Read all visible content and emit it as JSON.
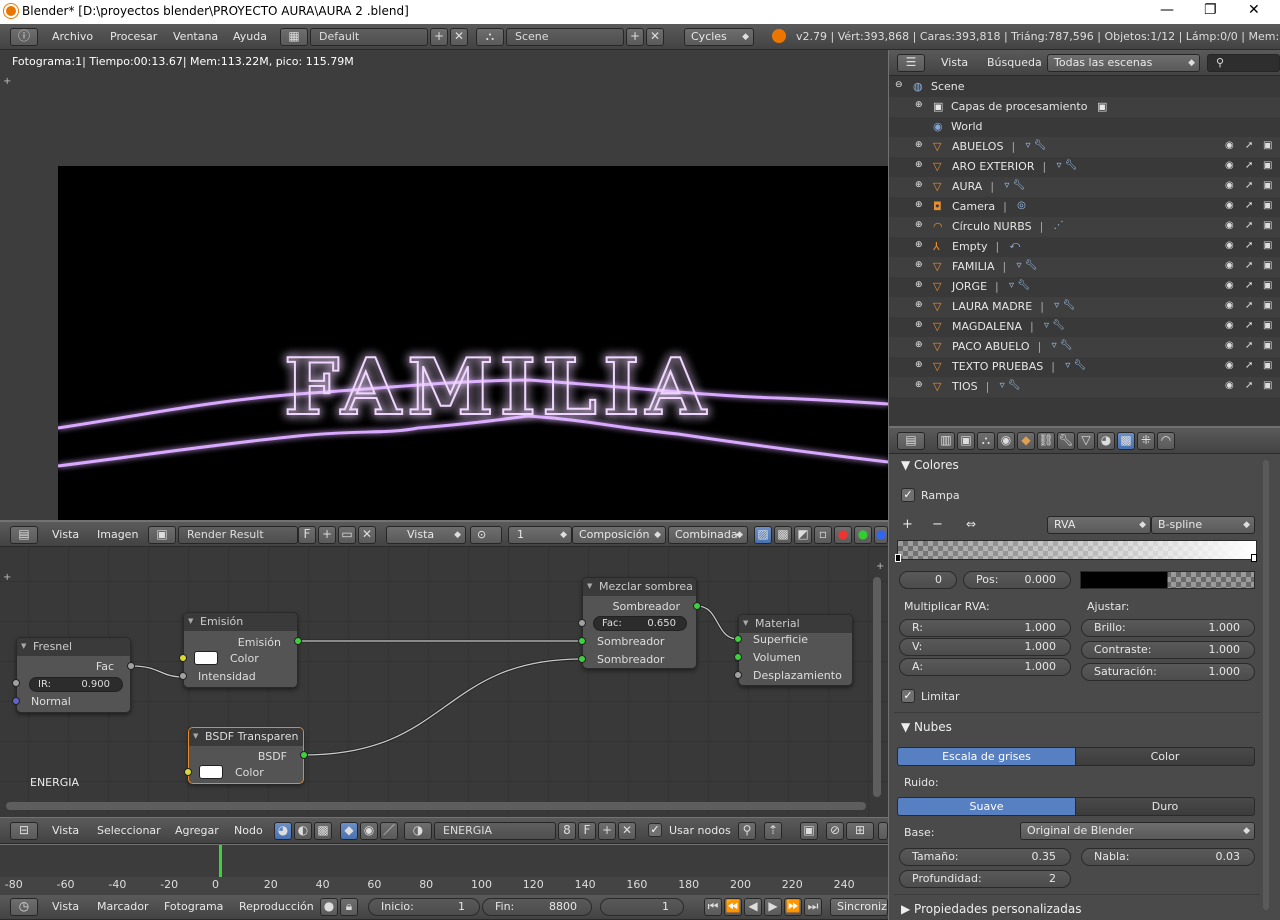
{
  "window": {
    "title": "Blender* [D:\\proyectos blender\\PROYECTO AURA\\AURA 2 .blend]"
  },
  "info_header": {
    "menus": [
      "Archivo",
      "Procesar",
      "Ventana",
      "Ayuda"
    ],
    "layout": "Default",
    "scene": "Scene",
    "engine": "Cycles",
    "stats": "v2.79 | Vért:393,868 | Caras:393,818 | Triáng:787,596 | Objetos:1/12 | Lámp:0/0 | Mem:373.5"
  },
  "render_view": {
    "info": "Fotograma:1| Tiempo:00:13.67| Mem:113.22M, pico: 115.79M",
    "text": "FAMILIA",
    "glow_color": "#c98cff"
  },
  "image_header": {
    "menus": [
      "Vista",
      "Imagen"
    ],
    "image": "Render Result",
    "f_label": "F",
    "view": "Vista",
    "slot": "1",
    "layer": "Composición",
    "pass": "Combinada"
  },
  "nodes": {
    "fresnel": {
      "title": "Fresnel",
      "out": "Fac",
      "field_label": "IR:",
      "field_value": "0.900",
      "in": "Normal"
    },
    "emission": {
      "title": "Emisión",
      "out": "Emisión",
      "color": "Color",
      "strength": "Intensidad"
    },
    "mix": {
      "title": "Mezclar sombrea",
      "out": "Sombreador",
      "fac_label": "Fac:",
      "fac_value": "0.650",
      "in1": "Sombreador",
      "in2": "Sombreador"
    },
    "material": {
      "title": "Material",
      "in1": "Superficie",
      "in2": "Volumen",
      "in3": "Desplazamiento"
    },
    "transparent": {
      "title": "BSDF Transparen",
      "out": "BSDF",
      "color": "Color"
    },
    "tree_label": "ENERGIA"
  },
  "node_header": {
    "menus": [
      "Vista",
      "Seleccionar",
      "Agregar",
      "Nodo"
    ],
    "material": "ENERGIA",
    "users": "8",
    "f_label": "F",
    "use_nodes_label": "Usar nodos",
    "use_nodes": true
  },
  "timeline": {
    "ticks": [
      "-80",
      "-60",
      "-40",
      "-20",
      "0",
      "20",
      "40",
      "60",
      "80",
      "100",
      "120",
      "140",
      "160",
      "180",
      "200",
      "220",
      "240"
    ],
    "menus": [
      "Vista",
      "Marcador",
      "Fotograma",
      "Reproducción"
    ],
    "start_label": "Inicio:",
    "start": "1",
    "end_label": "Fin:",
    "end": "8800",
    "current": "1",
    "sync": "Sincroniza"
  },
  "outliner": {
    "menus": [
      "Vista",
      "Búsqueda"
    ],
    "filter": "Todas las escenas",
    "scene": "Scene",
    "render_layers": "Capas de procesamiento",
    "world": "World",
    "objects": [
      {
        "name": "ABUELOS",
        "type": "mesh"
      },
      {
        "name": "ARO EXTERIOR",
        "type": "mesh"
      },
      {
        "name": "AURA",
        "type": "mesh"
      },
      {
        "name": "Camera",
        "type": "camera"
      },
      {
        "name": "Círculo NURBS",
        "type": "curve"
      },
      {
        "name": "Empty",
        "type": "empty"
      },
      {
        "name": "FAMILIA",
        "type": "mesh"
      },
      {
        "name": "JORGE",
        "type": "mesh"
      },
      {
        "name": "LAURA MADRE",
        "type": "mesh"
      },
      {
        "name": "MAGDALENA",
        "type": "mesh"
      },
      {
        "name": "PACO ABUELO",
        "type": "mesh"
      },
      {
        "name": "TEXTO PRUEBAS",
        "type": "mesh"
      },
      {
        "name": "TIOS",
        "type": "mesh"
      }
    ]
  },
  "properties": {
    "colores": {
      "title": "Colores",
      "ramp_label": "Rampa",
      "ramp": true,
      "color_mode": "RVA",
      "interp": "B-spline",
      "index": "0",
      "pos_label": "Pos:",
      "pos": "0.000",
      "mult_label": "Multiplicar RVA:",
      "adjust_label": "Ajustar:",
      "r_label": "R:",
      "r": "1.000",
      "g_label": "V:",
      "g": "1.000",
      "a_label": "A:",
      "a": "1.000",
      "bright_label": "Brillo:",
      "bright": "1.000",
      "contrast_label": "Contraste:",
      "contrast": "1.000",
      "sat_label": "Saturación:",
      "sat": "1.000",
      "clamp_label": "Limitar",
      "clamp": true
    },
    "nubes": {
      "title": "Nubes",
      "gray": "Escala de grises",
      "color": "Color",
      "noise_label": "Ruido:",
      "soft": "Suave",
      "hard": "Duro",
      "basis_label": "Base:",
      "basis": "Original de Blender",
      "size_label": "Tamaño:",
      "size": "0.35",
      "nabla_label": "Nabla:",
      "nabla": "0.03",
      "depth_label": "Profundidad:",
      "depth": "2"
    },
    "custom": "Propiedades personalizadas"
  }
}
